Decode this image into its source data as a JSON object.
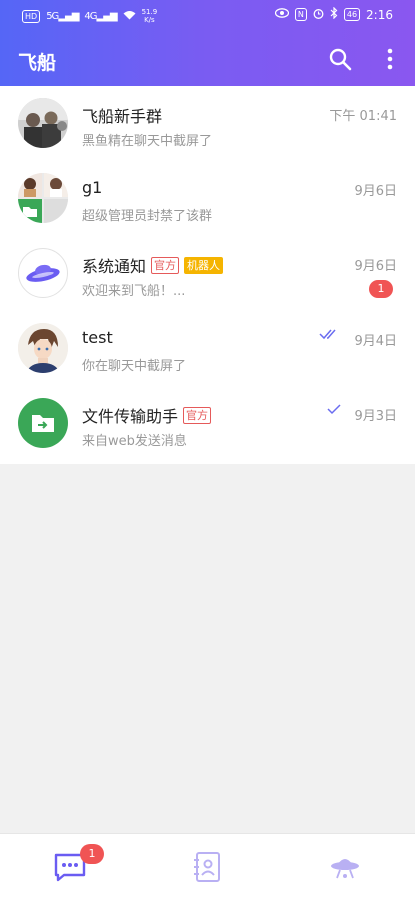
{
  "status_bar": {
    "net_left": "HD",
    "signal1": "5G",
    "signal2": "4G",
    "speed_value": "51.9",
    "speed_unit": "K/s",
    "nfc": "N",
    "battery": "46",
    "time": "2:16"
  },
  "app_bar": {
    "title": "飞船"
  },
  "chats": [
    {
      "name": "飞船新手群",
      "preview": "黑鱼精在聊天中截屏了",
      "time": "下午 01:41"
    },
    {
      "name": "g1",
      "preview": "超级管理员封禁了该群",
      "time": "9月6日"
    },
    {
      "name": "系统通知",
      "tag_official": "官方",
      "tag_bot": "机器人",
      "preview": "欢迎来到飞船！...",
      "time": "9月6日",
      "unread": "1"
    },
    {
      "name": "test",
      "preview": "你在聊天中截屏了",
      "time": "9月4日"
    },
    {
      "name": "文件传输助手",
      "tag_official": "官方",
      "preview": "来自web发送消息",
      "time": "9月3日"
    }
  ],
  "bottom_nav": {
    "chat_badge": "1"
  },
  "colors": {
    "accent": "#6a5cf2",
    "badge": "#f05454",
    "bot_tag": "#f5b400",
    "file_green": "#3aa757"
  }
}
